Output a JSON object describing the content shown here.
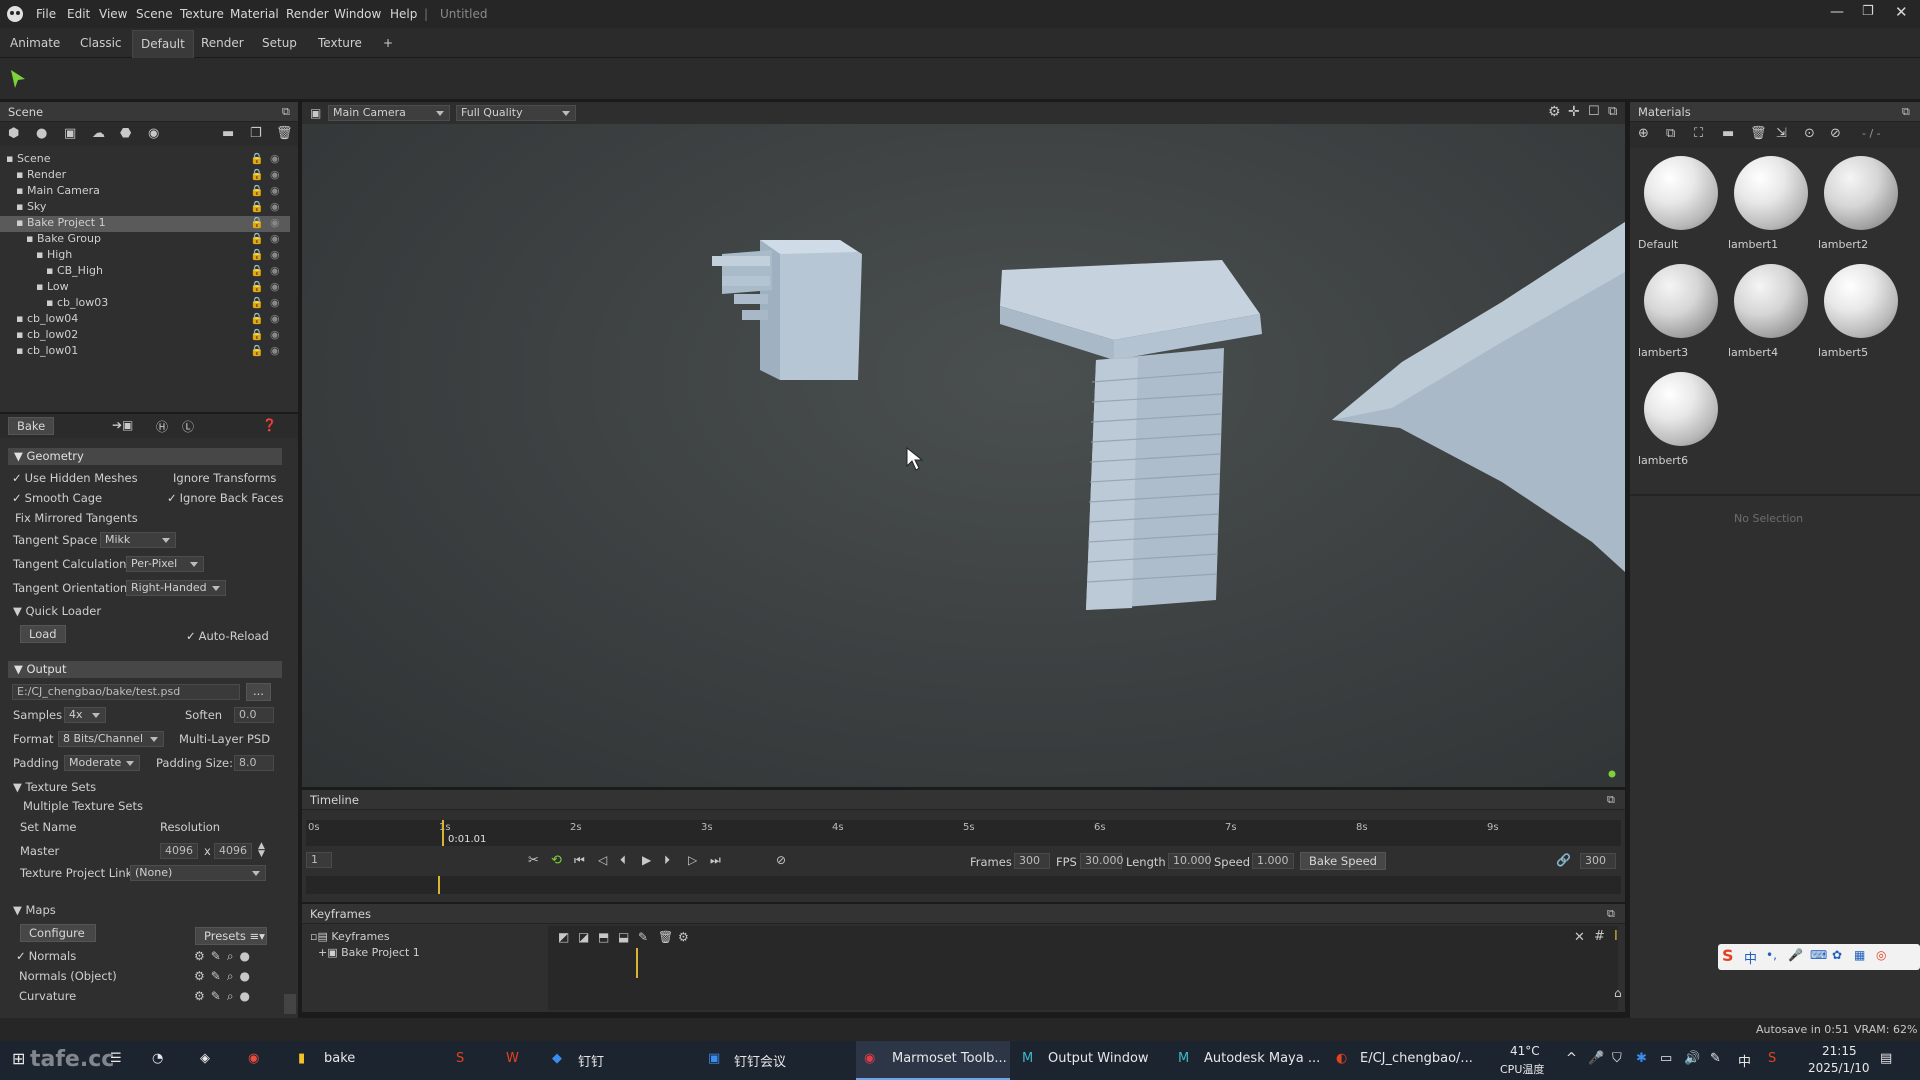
{
  "menu": {
    "items": [
      "File",
      "Edit",
      "View",
      "Scene",
      "Texture",
      "Material",
      "Render",
      "Window",
      "Help"
    ],
    "doc_title": "Untitled"
  },
  "tabs": [
    "Animate",
    "Classic",
    "Default",
    "Render",
    "Setup",
    "Texture",
    "+"
  ],
  "active_tab": "Default",
  "scene_panel": {
    "title": "Scene",
    "tree": [
      {
        "label": "Scene",
        "depth": 0,
        "icon": "scene-icon"
      },
      {
        "label": "Render",
        "depth": 1,
        "icon": "render-icon"
      },
      {
        "label": "Main Camera",
        "depth": 1,
        "icon": "camera-icon"
      },
      {
        "label": "Sky",
        "depth": 1,
        "icon": "sky-icon"
      },
      {
        "label": "Bake Project 1",
        "depth": 1,
        "icon": "bake-project-icon",
        "selected": true
      },
      {
        "label": "Bake Group",
        "depth": 2,
        "icon": "folder-icon"
      },
      {
        "label": "High",
        "depth": 3,
        "icon": "high-icon"
      },
      {
        "label": "CB_High",
        "depth": 4,
        "icon": "mesh-icon"
      },
      {
        "label": "Low",
        "depth": 3,
        "icon": "low-icon"
      },
      {
        "label": "cb_low03",
        "depth": 4,
        "icon": "mesh-icon"
      },
      {
        "label": "cb_low04",
        "depth": 1,
        "icon": "mesh-icon"
      },
      {
        "label": "cb_low02",
        "depth": 1,
        "icon": "mesh-icon"
      },
      {
        "label": "cb_low01",
        "depth": 1,
        "icon": "mesh-icon"
      }
    ]
  },
  "bake_panel": {
    "tab": "Bake",
    "geometry_header": "Geometry",
    "use_hidden_meshes": "Use Hidden Meshes",
    "ignore_transforms": "Ignore Transforms",
    "smooth_cage": "Smooth Cage",
    "ignore_back_faces": "Ignore Back Faces",
    "fix_mirrored_tangents": "Fix Mirrored Tangents",
    "tangent_space_label": "Tangent Space",
    "tangent_space_value": "Mikk",
    "tangent_calc_label": "Tangent Calculation",
    "tangent_calc_value": "Per-Pixel",
    "tangent_orient_label": "Tangent Orientation",
    "tangent_orient_value": "Right-Handed",
    "quick_loader_header": "Quick Loader",
    "load_button": "Load",
    "auto_reload": "Auto-Reload",
    "output_header": "Output",
    "output_path": "E:/CJ_chengbao/bake/test.psd",
    "browse_button": "...",
    "samples_label": "Samples",
    "samples_value": "4x",
    "soften_label": "Soften",
    "soften_value": "0.0",
    "format_label": "Format",
    "format_value": "8 Bits/Channel",
    "multi_layer_psd": "Multi-Layer PSD",
    "padding_label": "Padding",
    "padding_value": "Moderate",
    "padding_size_label": "Padding Size:",
    "padding_size_value": "8.0",
    "texture_sets_header": "Texture Sets",
    "multiple_texture_sets": "Multiple Texture Sets",
    "set_name_label": "Set Name",
    "resolution_label": "Resolution",
    "master_label": "Master",
    "res_w": "4096",
    "res_x": "x",
    "res_h": "4096",
    "texture_project_link_label": "Texture Project Link",
    "texture_project_link_value": "(None)",
    "maps_header": "Maps",
    "configure_button": "Configure",
    "presets_button": "Presets",
    "maps": [
      "Normals",
      "Normals (Object)",
      "Curvature"
    ]
  },
  "viewport": {
    "camera": "Main Camera",
    "quality": "Full Quality"
  },
  "materials": {
    "title": "Materials",
    "counter": "- / -",
    "items": [
      "Default",
      "lambert1",
      "lambert2",
      "lambert3",
      "lambert4",
      "lambert5",
      "lambert6"
    ],
    "no_selection": "No Selection"
  },
  "timeline": {
    "title": "Timeline",
    "ticks": [
      "0s",
      "1s",
      "2s",
      "3s",
      "4s",
      "5s",
      "6s",
      "7s",
      "8s",
      "9s"
    ],
    "current_time": "0:01.01",
    "current_frame": "1",
    "frames_label": "Frames",
    "frames_value": "300",
    "fps_label": "FPS",
    "fps_value": "30.000",
    "length_label": "Length",
    "length_value": "10.000",
    "speed_label": "Speed",
    "speed_value": "1.000",
    "bake_speed_button": "Bake Speed",
    "end_frame": "300"
  },
  "keyframes": {
    "title": "Keyframes",
    "tree_root": "Keyframes",
    "tree_child": "Bake Project 1"
  },
  "status": {
    "autosave": "Autosave in 0:51",
    "vram": "VRAM: 62%"
  },
  "taskbar": {
    "items": [
      "bake",
      "钉钉",
      "钉钉会议",
      "Marmoset Toolb...",
      "Output Window",
      "Autodesk Maya ...",
      "E/CJ_chengbao/..."
    ],
    "temp": "41°C",
    "temp_label": "CPU温度",
    "time": "21:15",
    "date": "2025/1/10",
    "ime": "中",
    "watermark": "tafe.cc"
  },
  "colors": {
    "accent_yellow": "#d9b536",
    "play_green": "#7fd13b",
    "selection": "#5a5a5a",
    "viewport_bg": "#3e4243",
    "mesh": "#b8c8d8"
  }
}
